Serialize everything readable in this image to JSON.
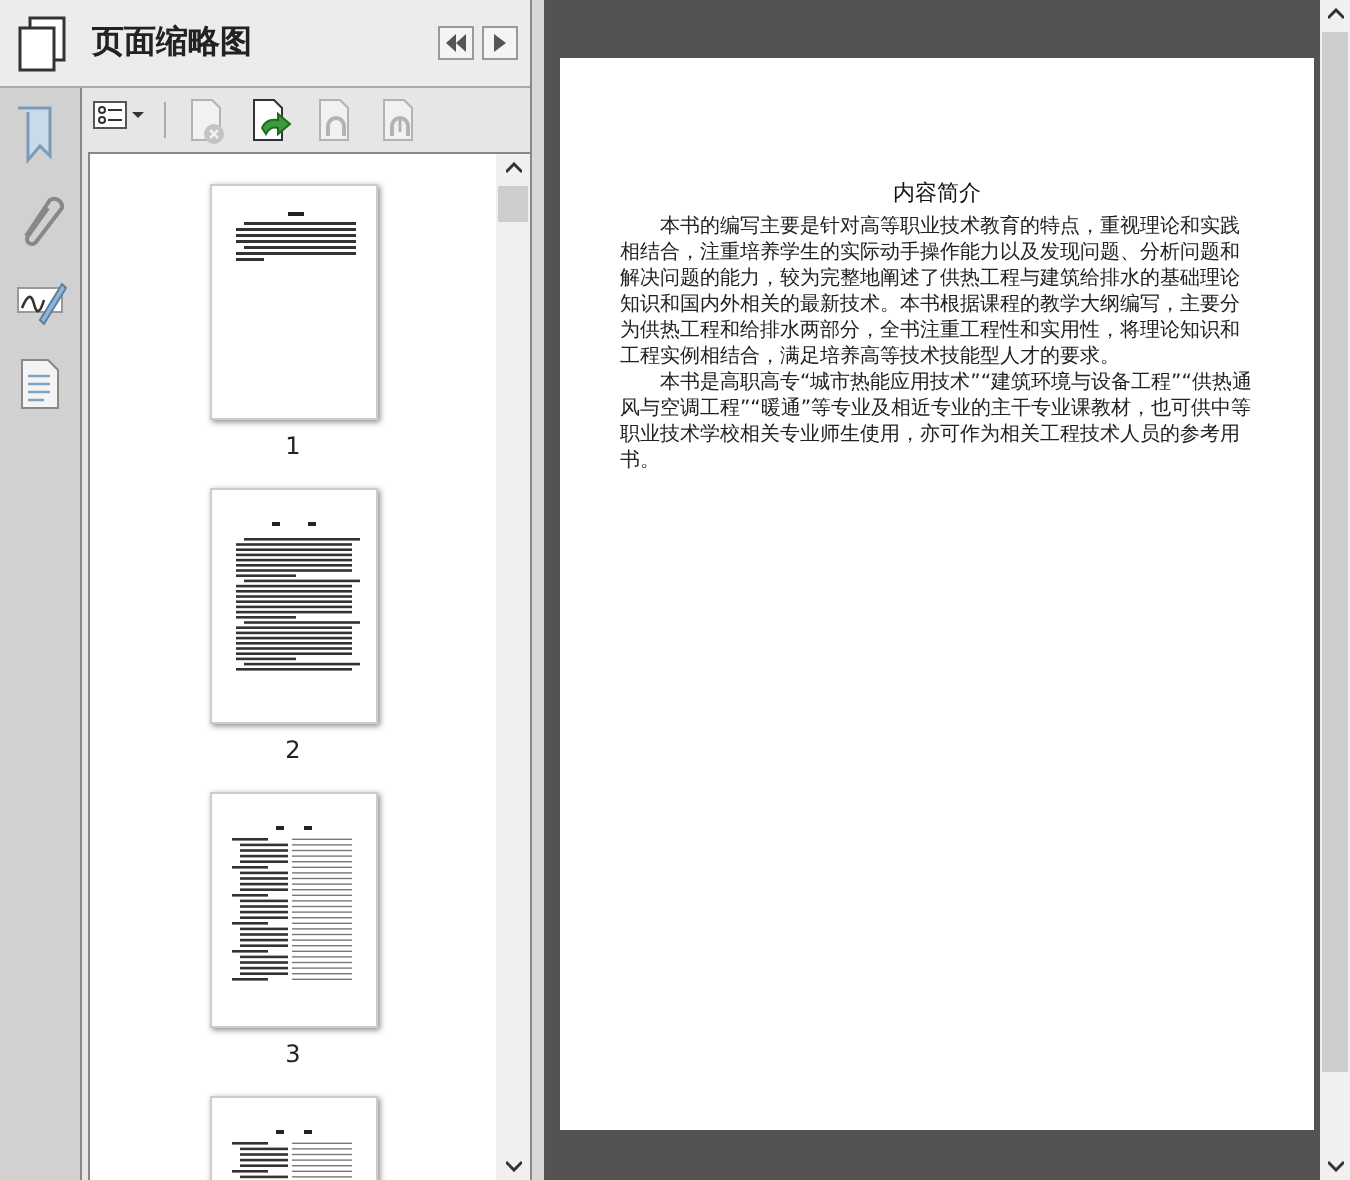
{
  "panel": {
    "title": "页面缩略图"
  },
  "side_icons": [
    {
      "kind": "bookmark"
    },
    {
      "kind": "attachment"
    },
    {
      "kind": "signature"
    },
    {
      "kind": "page"
    }
  ],
  "toolbar": [
    {
      "kind": "options",
      "disabled": false
    },
    {
      "kind": "delete",
      "disabled": true
    },
    {
      "kind": "insert",
      "disabled": false
    },
    {
      "kind": "undo",
      "disabled": true
    },
    {
      "kind": "redo",
      "disabled": true
    }
  ],
  "thumbnails": [
    {
      "kind": "intro",
      "label": "1"
    },
    {
      "kind": "preface",
      "label": "2"
    },
    {
      "kind": "contents",
      "label": "3"
    },
    {
      "kind": "contents"
    }
  ],
  "document": {
    "heading": "内容简介",
    "paragraphs": [
      "本书的编写主要是针对高等职业技术教育的特点，重视理论和实践相结合，注重培养学生的实际动手操作能力以及发现问题、分析问题和解决问题的能力，较为完整地阐述了供热工程与建筑给排水的基础理论知识和国内外相关的最新技术。本书根据课程的教学大纲编写，主要分为供热工程和给排水两部分，全书注重工程性和实用性，将理论知识和工程实例相结合，满足培养高等技术技能型人才的要求。",
      "本书是高职高专“城市热能应用技术”“建筑环境与设备工程”“供热通风与空调工程”“暖通”等专业及相近专业的主干专业课教材，也可供中等职业技术学校相关专业师生使用，亦可作为相关工程技术人员的参考用书。"
    ]
  }
}
